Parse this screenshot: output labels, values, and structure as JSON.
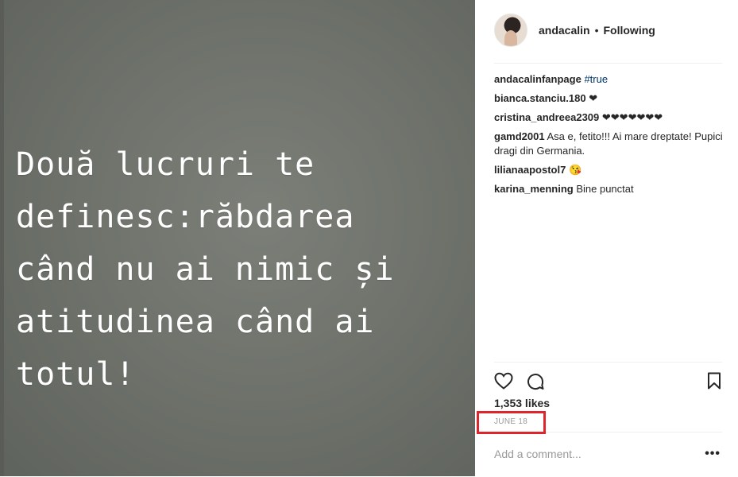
{
  "post": {
    "image_text_lines": [
      "Două lucruri te",
      "definesc:răbdarea",
      "când nu ai nimic și",
      "atitudinea când ai",
      "totul!"
    ],
    "author": "andacalin",
    "separator": "•",
    "follow_status": "Following",
    "likes": "1,353 likes",
    "date": "JUNE 18",
    "add_comment_placeholder": "Add a comment...",
    "more_options": "•••"
  },
  "comments": [
    {
      "user": "andacalinfanpage",
      "text": "#true",
      "is_hashtag": true
    },
    {
      "user": "bianca.stanciu.180",
      "text": "❤"
    },
    {
      "user": "cristina_andreea2309",
      "text": "❤❤❤❤❤❤❤"
    },
    {
      "user": "gamd2001",
      "text": "Asa e, fetito!!! Ai mare dreptate! Pupici dragi din Germania."
    },
    {
      "user": "lilianaapostol7",
      "text": "😘"
    },
    {
      "user": "karina_menning",
      "text": "Bine punctat"
    }
  ],
  "icons": {
    "like": "heart-icon",
    "comment": "comment-bubble-icon",
    "save": "bookmark-icon"
  },
  "colors": {
    "hashtag": "#003569",
    "highlight_box": "#e0242c"
  }
}
